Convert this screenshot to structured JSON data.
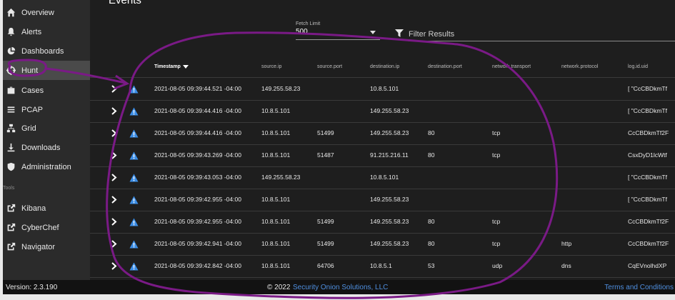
{
  "sidebar": {
    "items": [
      {
        "label": "Overview",
        "icon": "home-icon"
      },
      {
        "label": "Alerts",
        "icon": "bell-icon"
      },
      {
        "label": "Dashboards",
        "icon": "pie-chart-icon"
      },
      {
        "label": "Hunt",
        "icon": "crosshair-icon",
        "active": true
      },
      {
        "label": "Cases",
        "icon": "briefcase-icon"
      },
      {
        "label": "PCAP",
        "icon": "list-icon"
      },
      {
        "label": "Grid",
        "icon": "grid-icon"
      },
      {
        "label": "Downloads",
        "icon": "download-icon"
      },
      {
        "label": "Administration",
        "icon": "shield-icon"
      }
    ],
    "tools_label": "Tools",
    "tools": [
      {
        "label": "Kibana",
        "icon": "external-link-icon"
      },
      {
        "label": "CyberChef",
        "icon": "external-link-icon"
      },
      {
        "label": "Navigator",
        "icon": "external-link-icon"
      }
    ]
  },
  "panel": {
    "title": "Events"
  },
  "fetch_limit": {
    "label": "Fetch Limit",
    "value": "500"
  },
  "filter": {
    "placeholder": "Filter Results"
  },
  "table": {
    "columns": [
      "Timestamp",
      "source.ip",
      "source.port",
      "destination.ip",
      "destination.port",
      "network.transport",
      "network.protocol",
      "log.id.uid"
    ],
    "sorted_column": "Timestamp",
    "rows": [
      [
        "2021-08-05 09:39:44.521 -04:00",
        "149.255.58.23",
        "",
        "10.8.5.101",
        "",
        "",
        "",
        "[ \"CcCBDkmTf"
      ],
      [
        "2021-08-05 09:39:44.416 -04:00",
        "10.8.5.101",
        "",
        "149.255.58.23",
        "",
        "",
        "",
        "[ \"CcCBDkmTf"
      ],
      [
        "2021-08-05 09:39:44.416 -04:00",
        "10.8.5.101",
        "51499",
        "149.255.58.23",
        "80",
        "tcp",
        "",
        "CcCBDkmTf2F"
      ],
      [
        "2021-08-05 09:39:43.269 -04:00",
        "10.8.5.101",
        "51487",
        "91.215.216.11",
        "80",
        "tcp",
        "",
        "CsxDyD1lcWtf"
      ],
      [
        "2021-08-05 09:39:43.053 -04:00",
        "149.255.58.23",
        "",
        "10.8.5.101",
        "",
        "",
        "",
        "[ \"CcCBDkmTf"
      ],
      [
        "2021-08-05 09:39:42.955 -04:00",
        "10.8.5.101",
        "",
        "149.255.58.23",
        "",
        "",
        "",
        "[ \"CcCBDkmTf"
      ],
      [
        "2021-08-05 09:39:42.955 -04:00",
        "10.8.5.101",
        "51499",
        "149.255.58.23",
        "80",
        "tcp",
        "",
        "CcCBDkmTf2F"
      ],
      [
        "2021-08-05 09:39:42.941 -04:00",
        "10.8.5.101",
        "51499",
        "149.255.58.23",
        "80",
        "tcp",
        "http",
        "CcCBDkmTf2F"
      ],
      [
        "2021-08-05 09:39:42.842 -04:00",
        "10.8.5.101",
        "64706",
        "10.8.5.1",
        "53",
        "udp",
        "dns",
        "CqEVnolhdXP"
      ]
    ]
  },
  "footer": {
    "version": "Version: 2.3.190",
    "copyright": "© 2022",
    "company": "Security Onion Solutions, LLC",
    "terms": "Terms and Conditions"
  },
  "colors": {
    "accent_link": "#4f8fe0",
    "alert_icon": "#3b8de6",
    "annotation_ink": "#7a1a86"
  }
}
